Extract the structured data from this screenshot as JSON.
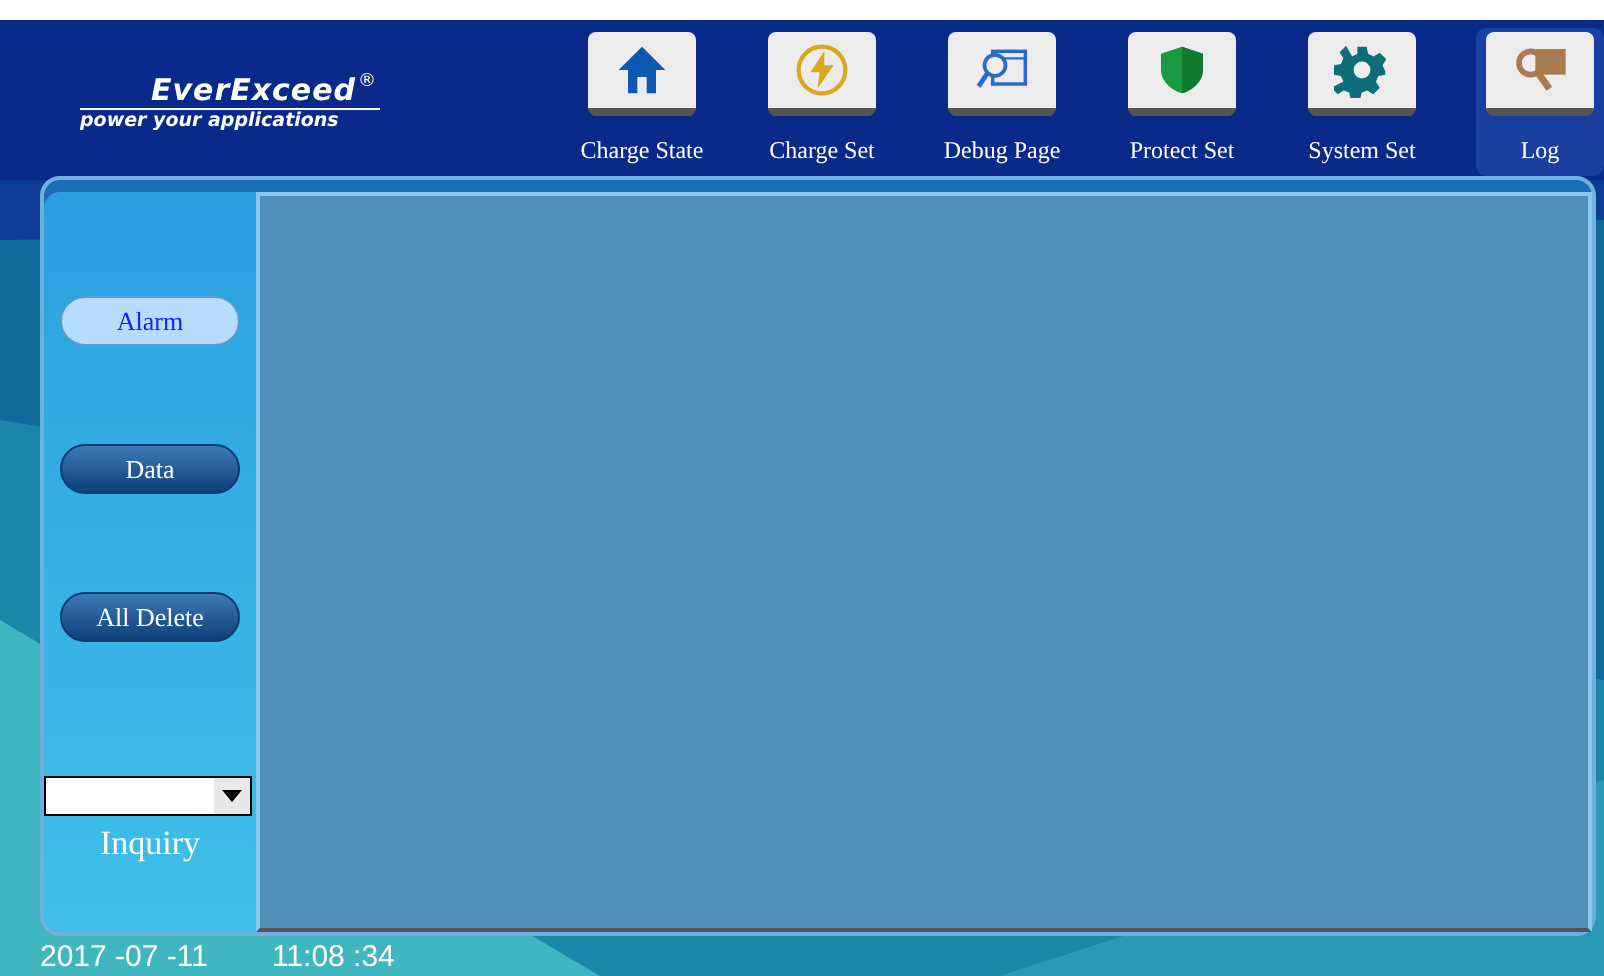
{
  "logo": {
    "name": "EverExceed",
    "mark": "®",
    "tagline": "power your applications"
  },
  "nav": [
    {
      "label": "Charge State",
      "kind": "home",
      "selected": false
    },
    {
      "label": "Charge Set",
      "kind": "bolt",
      "selected": false
    },
    {
      "label": "Debug Page",
      "kind": "debug",
      "selected": false
    },
    {
      "label": "Protect Set",
      "kind": "shield",
      "selected": false
    },
    {
      "label": "System Set",
      "kind": "gear",
      "selected": false
    },
    {
      "label": "Log",
      "kind": "log",
      "selected": true
    }
  ],
  "sidebar": {
    "buttons": [
      {
        "label": "Alarm",
        "selected": true
      },
      {
        "label": "Data",
        "selected": false
      },
      {
        "label": "All Delete",
        "selected": false
      }
    ],
    "inquiry": {
      "label": "Inquiry"
    }
  },
  "status_bar": {
    "date": "2017 -07 -11",
    "time": "11:08 :34"
  }
}
